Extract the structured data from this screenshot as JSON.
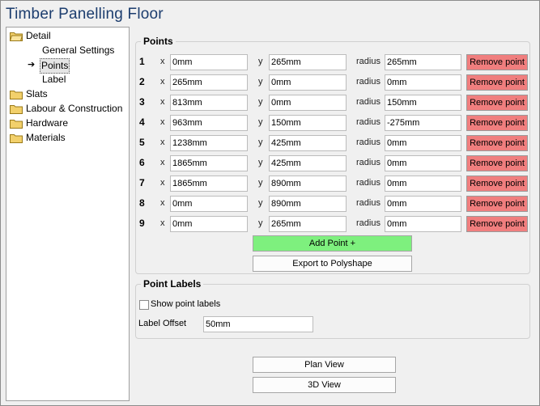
{
  "window": {
    "title": "Timber Panelling Floor"
  },
  "tree": {
    "detail": "Detail",
    "general_settings": "General Settings",
    "points": "Points",
    "label": "Label",
    "slats": "Slats",
    "labour": "Labour & Construction",
    "hardware": "Hardware",
    "materials": "Materials"
  },
  "points_group": {
    "title": "Points",
    "x_label": "x",
    "y_label": "y",
    "radius_label": "radius",
    "remove_label": "Remove point",
    "rows": [
      {
        "num": "1",
        "x": "0mm",
        "y": "265mm",
        "r": "265mm"
      },
      {
        "num": "2",
        "x": "265mm",
        "y": "0mm",
        "r": "0mm"
      },
      {
        "num": "3",
        "x": "813mm",
        "y": "0mm",
        "r": "150mm"
      },
      {
        "num": "4",
        "x": "963mm",
        "y": "150mm",
        "r": "-275mm"
      },
      {
        "num": "5",
        "x": "1238mm",
        "y": "425mm",
        "r": "0mm"
      },
      {
        "num": "6",
        "x": "1865mm",
        "y": "425mm",
        "r": "0mm"
      },
      {
        "num": "7",
        "x": "1865mm",
        "y": "890mm",
        "r": "0mm"
      },
      {
        "num": "8",
        "x": "0mm",
        "y": "890mm",
        "r": "0mm"
      },
      {
        "num": "9",
        "x": "0mm",
        "y": "265mm",
        "r": "0mm"
      }
    ],
    "add_label": "Add Point +",
    "export_label": "Export to Polyshape"
  },
  "labels_group": {
    "title": "Point Labels",
    "show_label": "Show point labels",
    "show_checked": false,
    "offset_label": "Label Offset",
    "offset_value": "50mm"
  },
  "buttons": {
    "plan": "Plan View",
    "view3d": "3D  View"
  },
  "colors": {
    "remove": "#f07e7e",
    "add": "#7ef07e",
    "title": "#1c3d6e",
    "folder": "#f2d06b"
  }
}
